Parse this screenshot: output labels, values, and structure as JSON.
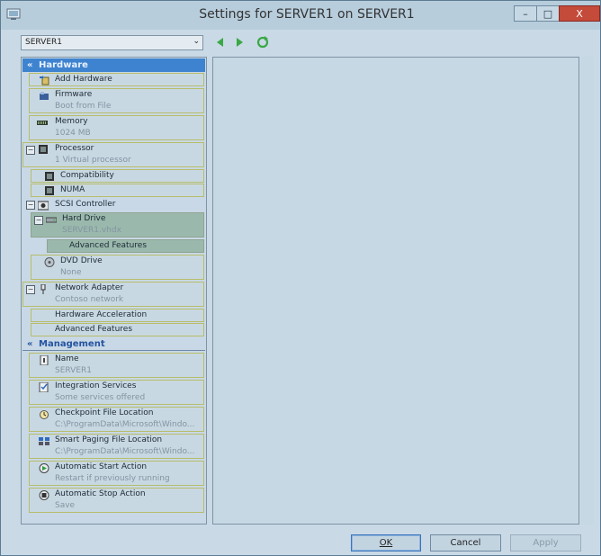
{
  "window": {
    "title": "Settings for SERVER1 on SERVER1",
    "buttons": {
      "minimize": "–",
      "maximize": "□",
      "close": "X"
    }
  },
  "vm_selector": {
    "value": "SERVER1"
  },
  "tree": {
    "hardware": {
      "header": "Hardware",
      "items": [
        {
          "label": "Add Hardware",
          "sub": ""
        },
        {
          "label": "Firmware",
          "sub": "Boot from File"
        },
        {
          "label": "Memory",
          "sub": "1024 MB"
        },
        {
          "label": "Processor",
          "sub": "1 Virtual processor"
        },
        {
          "label": "Compatibility",
          "sub": ""
        },
        {
          "label": "NUMA",
          "sub": ""
        },
        {
          "label": "SCSI Controller",
          "sub": ""
        },
        {
          "label": "Hard Drive",
          "sub": "SERVER1.vhdx"
        },
        {
          "label": "Advanced Features",
          "sub": ""
        },
        {
          "label": "DVD Drive",
          "sub": "None"
        },
        {
          "label": "Network Adapter",
          "sub": "Contoso network"
        },
        {
          "label": "Hardware Acceleration",
          "sub": ""
        },
        {
          "label": "Advanced Features",
          "sub": ""
        }
      ]
    },
    "management": {
      "header": "Management",
      "items": [
        {
          "label": "Name",
          "sub": "SERVER1"
        },
        {
          "label": "Integration Services",
          "sub": "Some services offered"
        },
        {
          "label": "Checkpoint File Location",
          "sub": "C:\\ProgramData\\Microsoft\\Windo..."
        },
        {
          "label": "Smart Paging File Location",
          "sub": "C:\\ProgramData\\Microsoft\\Windo..."
        },
        {
          "label": "Automatic Start Action",
          "sub": "Restart if previously running"
        },
        {
          "label": "Automatic Stop Action",
          "sub": "Save"
        }
      ]
    }
  },
  "footer": {
    "ok_label": "OK",
    "cancel_label": "Cancel",
    "apply_label": "Apply"
  },
  "colors": {
    "accent": "#3e83cf",
    "selected": "#9ab9ac",
    "item_border": "#b7bd6a",
    "close_button": "#c44a3a"
  }
}
